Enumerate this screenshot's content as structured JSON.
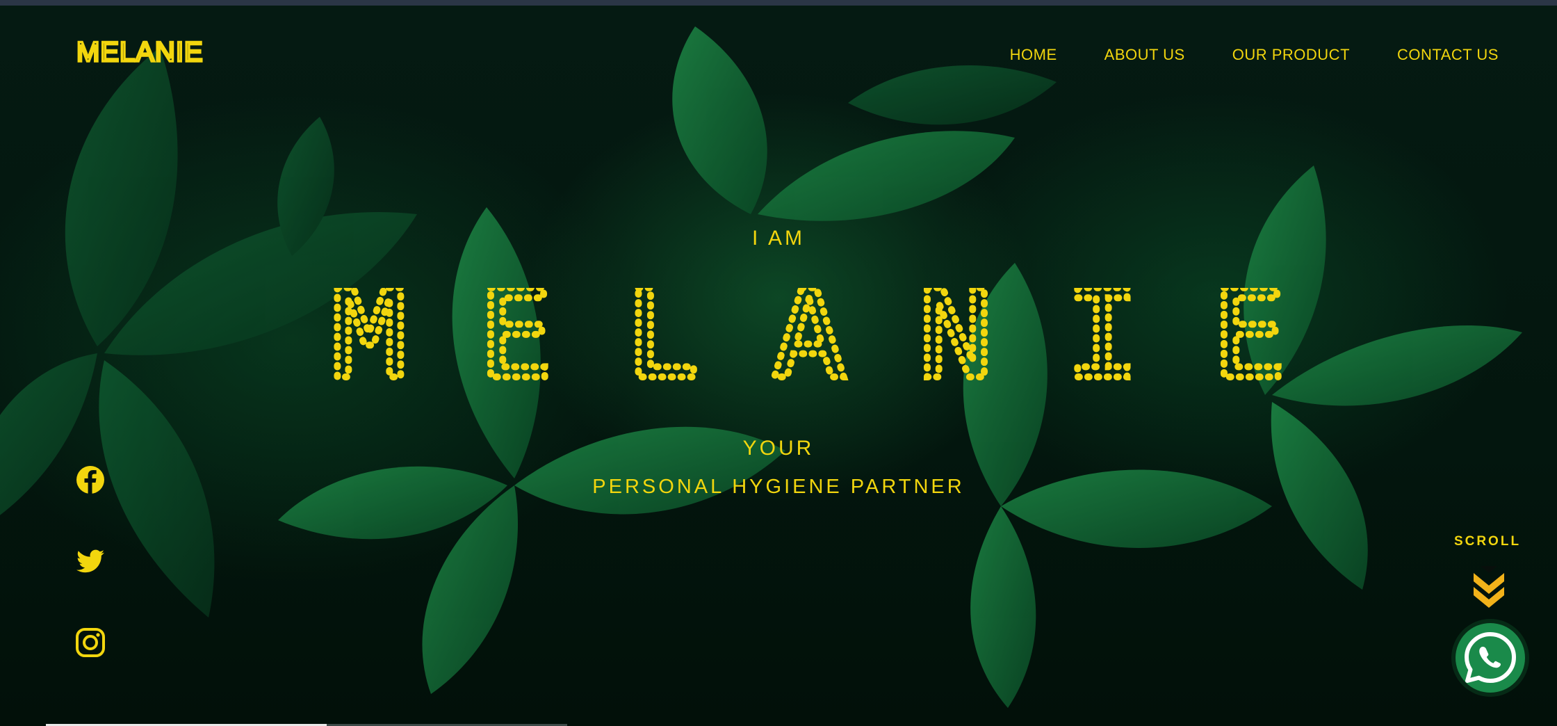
{
  "brand": {
    "logo_text": "MELANIE"
  },
  "nav": {
    "items": [
      {
        "label": "HOME"
      },
      {
        "label": "ABOUT US"
      },
      {
        "label": "OUR PRODUCT"
      },
      {
        "label": "CONTACT US"
      }
    ]
  },
  "hero": {
    "pre_title": "I AM",
    "title": "MELANIE",
    "tagline_1": "YOUR",
    "tagline_2": "PERSONAL HYGIENE PARTNER"
  },
  "social": {
    "icons": [
      "facebook-icon",
      "twitter-icon",
      "instagram-icon"
    ]
  },
  "scroll": {
    "label": "SCROLL",
    "icon": "double-chevron-down-icon"
  },
  "whatsapp": {
    "icon": "whatsapp-icon"
  },
  "colors": {
    "accent": "#f2d60e",
    "scroll_arrow": "#f2b21a",
    "whatsapp": "#1a8a4a",
    "background": "#03130d"
  }
}
